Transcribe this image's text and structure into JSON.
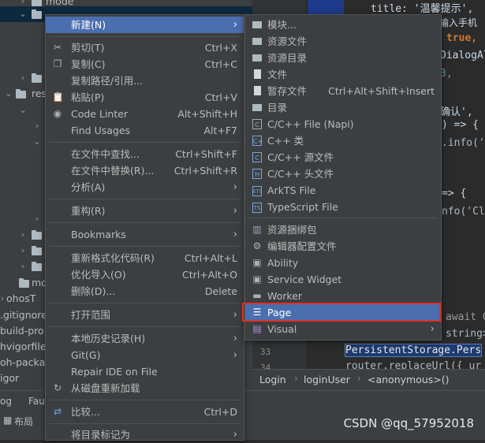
{
  "tree": {
    "rows": [
      "mode",
      "",
      "",
      "res",
      "",
      "",
      "",
      "",
      "",
      "mo",
      "ohosT",
      ".gitignore",
      "build-pro",
      "hvigorfile",
      "oh-packa",
      "igor"
    ]
  },
  "editor": {
    "code_lines": [
      "title: '温馨提示',",
      "请输入手机",
      "true,",
      "DialogAl",
      "3,",
      "确认',",
      ") => {",
      ".info('",
      "=> {",
      "nfo('Cl",
      "await G",
      "string>",
      "PersistentStorage.Pers",
      "router.replaceUrl({ ur"
    ],
    "line_numbers": [
      "33",
      "34"
    ],
    "breadcrumb": [
      "Login",
      "loginUser",
      "<anonymous>()"
    ]
  },
  "bottom": {
    "items": [
      "og",
      "Fau",
      "布局"
    ],
    "watermark": "CSDN @qq_57952018"
  },
  "menu1": {
    "items": [
      {
        "label": "新建(N)",
        "shortcut": "",
        "arrow": true
      },
      {
        "label": "剪切(T)",
        "shortcut": "Ctrl+X",
        "arrow": false,
        "icon": "cut-icon"
      },
      {
        "label": "复制(C)",
        "shortcut": "Ctrl+C",
        "arrow": false,
        "icon": "copy-icon"
      },
      {
        "label": "复制路径/引用...",
        "shortcut": "",
        "arrow": false
      },
      {
        "label": "粘贴(P)",
        "shortcut": "Ctrl+V",
        "arrow": false,
        "icon": "paste-icon"
      },
      {
        "label": "Code Linter",
        "shortcut": "Alt+Shift+H",
        "arrow": false,
        "icon": "linter-icon"
      },
      {
        "label": "Find Usages",
        "shortcut": "Alt+F7",
        "arrow": false
      },
      {
        "label": "在文件中查找...",
        "shortcut": "Ctrl+Shift+F",
        "arrow": false
      },
      {
        "label": "在文件中替换(R)...",
        "shortcut": "Ctrl+Shift+R",
        "arrow": false
      },
      {
        "label": "分析(A)",
        "shortcut": "",
        "arrow": true
      },
      {
        "label": "重构(R)",
        "shortcut": "",
        "arrow": true
      },
      {
        "label": "Bookmarks",
        "shortcut": "",
        "arrow": true
      },
      {
        "label": "重新格式化代码(R)",
        "shortcut": "Ctrl+Alt+L",
        "arrow": false
      },
      {
        "label": "优化导入(O)",
        "shortcut": "Ctrl+Alt+O",
        "arrow": false
      },
      {
        "label": "删除(D)...",
        "shortcut": "Delete",
        "arrow": false
      },
      {
        "label": "打开范围",
        "shortcut": "",
        "arrow": true
      },
      {
        "label": "本地历史记录(H)",
        "shortcut": "",
        "arrow": true
      },
      {
        "label": "Git(G)",
        "shortcut": "",
        "arrow": true
      },
      {
        "label": "Repair IDE on File",
        "shortcut": "",
        "arrow": false
      },
      {
        "label": "从磁盘重新加载",
        "shortcut": "",
        "arrow": false,
        "icon": "reload-icon"
      },
      {
        "label": "比较...",
        "shortcut": "Ctrl+D",
        "arrow": false,
        "icon": "compare-icon"
      },
      {
        "label": "将目录标记为",
        "shortcut": "",
        "arrow": true
      }
    ]
  },
  "menu2": {
    "items": [
      {
        "label": "模块...",
        "shortcut": ""
      },
      {
        "label": "资源文件",
        "shortcut": ""
      },
      {
        "label": "资源目录",
        "shortcut": ""
      },
      {
        "label": "文件",
        "shortcut": ""
      },
      {
        "label": "暂存文件",
        "shortcut": "Ctrl+Alt+Shift+Insert"
      },
      {
        "label": "目录",
        "shortcut": ""
      },
      {
        "label": "C/C++ File (Napi)",
        "shortcut": ""
      },
      {
        "label": "C++ 类",
        "shortcut": ""
      },
      {
        "label": "C/C++ 源文件",
        "shortcut": ""
      },
      {
        "label": "C/C++ 头文件",
        "shortcut": ""
      },
      {
        "label": "ArkTS File",
        "shortcut": ""
      },
      {
        "label": "TypeScript File",
        "shortcut": ""
      },
      {
        "label": "资源捆绑包",
        "shortcut": ""
      },
      {
        "label": "编辑器配置文件",
        "shortcut": ""
      },
      {
        "label": "Ability",
        "shortcut": ""
      },
      {
        "label": "Service Widget",
        "shortcut": ""
      },
      {
        "label": "Worker",
        "shortcut": ""
      },
      {
        "label": "Page",
        "shortcut": ""
      },
      {
        "label": "Visual",
        "shortcut": ""
      }
    ]
  },
  "colors": {
    "highlight": "#4b6eaf",
    "menu_bg": "#3c3f41",
    "red_box": "#e0302a"
  }
}
